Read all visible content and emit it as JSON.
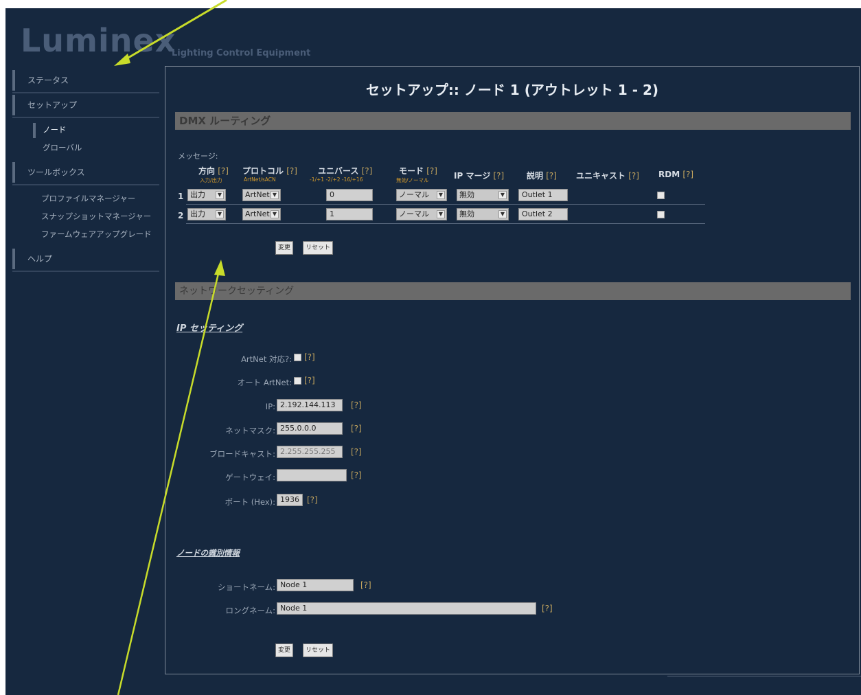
{
  "brand": {
    "logo": "Luminex",
    "tagline": "Lighting Control Equipment"
  },
  "sidebar": {
    "items": [
      {
        "label": "ステータス",
        "type": "main"
      },
      {
        "label": "セットアップ",
        "type": "main"
      },
      {
        "label": "ノード",
        "type": "sub",
        "active": true
      },
      {
        "label": "グローバル",
        "type": "sub"
      },
      {
        "label": "ツールボックス",
        "type": "main"
      },
      {
        "label": "プロファイルマネージャー",
        "type": "sub"
      },
      {
        "label": "スナップショットマネージャー",
        "type": "sub"
      },
      {
        "label": "ファームウェアアップグレード",
        "type": "sub"
      },
      {
        "label": "ヘルプ",
        "type": "main"
      }
    ]
  },
  "page_title": "セットアップ:: ノード 1 (アウトレット 1 - 2)",
  "dmx": {
    "section_title": "DMX ルーティング",
    "message_label": "メッセージ:",
    "help": "[?]",
    "columns": {
      "direction": "方向",
      "direction_sub": "入力/出力",
      "protocol": "プロトコル",
      "protocol_sub": "ArtNet/sACN",
      "universe": "ユニバース",
      "universe_sub": "-1/+1 -2/+2 -16/+16",
      "mode": "モード",
      "mode_sub": "無効/ノーマル",
      "ip_merge": "IP マージ",
      "description": "説明",
      "unicast": "ユニキャスト",
      "rdm": "RDM"
    },
    "rows": [
      {
        "num": "1",
        "direction": "出力",
        "protocol": "ArtNet",
        "universe": "0",
        "mode": "ノーマル",
        "ip_merge": "無効",
        "description": "Outlet 1"
      },
      {
        "num": "2",
        "direction": "出力",
        "protocol": "ArtNet",
        "universe": "1",
        "mode": "ノーマル",
        "ip_merge": "無効",
        "description": "Outlet 2"
      }
    ],
    "apply_label": "変更",
    "reset_label": "リセット"
  },
  "network": {
    "section_title": "ネットワークセッティング",
    "ip_heading": "IP セッティング",
    "artnet_compat_label": "ArtNet 対応?:",
    "auto_artnet_label": "オート ArtNet:",
    "ip_label": "IP:",
    "ip_value": "2.192.144.113",
    "netmask_label": "ネットマスク:",
    "netmask_value": "255.0.0.0",
    "broadcast_label": "ブロードキャスト:",
    "broadcast_value": "2.255.255.255",
    "gateway_label": "ゲートウェイ:",
    "gateway_value": "",
    "port_label": "ポート (Hex):",
    "port_value": "1936",
    "node_heading": "ノードの識別情報",
    "short_name_label": "ショートネーム:",
    "short_name_value": "Node 1",
    "long_name_label": "ロングネーム:",
    "long_name_value": "Node 1",
    "apply_label": "変更",
    "reset_label": "リセット"
  },
  "colors": {
    "background": "#16283f",
    "section_header": "#6a6a6a",
    "annotation_arrow": "#c8dc2a"
  }
}
